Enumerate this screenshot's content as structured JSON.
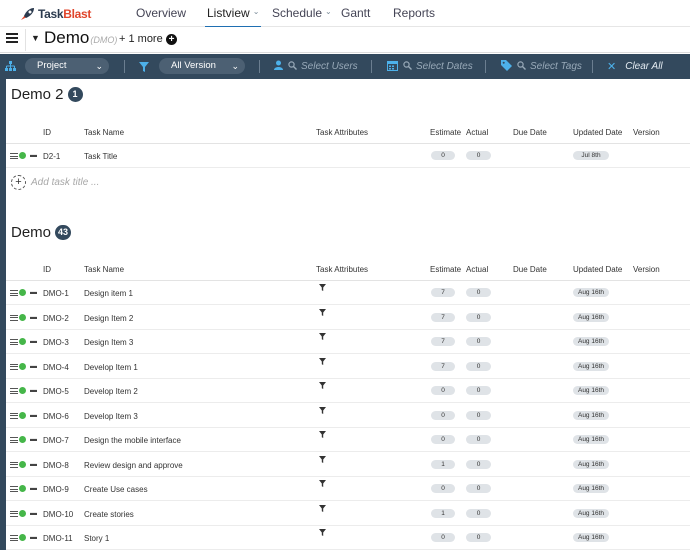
{
  "app": {
    "name_main": "Task",
    "name_accent": "Blast",
    "accent_color": "#e0452b",
    "brand_color": "#2b3a4e",
    "toolbar_color": "#33495d"
  },
  "nav": [
    {
      "label": "Overview",
      "has_caret": false,
      "active": false
    },
    {
      "label": "Listview",
      "has_caret": true,
      "active": true
    },
    {
      "label": "Schedule",
      "has_caret": true,
      "active": false
    },
    {
      "label": "Gantt",
      "has_caret": false,
      "active": false
    },
    {
      "label": "Reports",
      "has_caret": false,
      "active": false
    }
  ],
  "project": {
    "name": "Demo",
    "code": "(DMO)",
    "more": "+ 1 more",
    "menu_icon": "hamburger-icon",
    "add_icon": "plus-circle-icon"
  },
  "toolbar": {
    "group_by": "Project",
    "version": "All Version",
    "users_placeholder": "Select Users",
    "dates_placeholder": "Select Dates",
    "tags_placeholder": "Select Tags",
    "clear_all": "Clear All"
  },
  "columns": {
    "id": "ID",
    "task_name": "Task Name",
    "attributes": "Task Attributes",
    "estimate": "Estimate",
    "actual": "Actual",
    "due_date": "Due Date",
    "updated": "Updated Date",
    "version": "Version"
  },
  "sections": [
    {
      "title": "Demo 2",
      "count": "1",
      "add_placeholder": "Add task title ...",
      "tasks": [
        {
          "id": "D2-1",
          "name": "Task Title",
          "estimate": "0",
          "actual": "0",
          "updated": "Jul 8th",
          "has_attr": false
        }
      ]
    },
    {
      "title": "Demo",
      "count": "43",
      "tasks": [
        {
          "id": "DMO-1",
          "name": "Design item 1",
          "estimate": "7",
          "actual": "0",
          "updated": "Aug 16th",
          "has_attr": true
        },
        {
          "id": "DMO-2",
          "name": "Design Item 2",
          "estimate": "7",
          "actual": "0",
          "updated": "Aug 16th",
          "has_attr": true
        },
        {
          "id": "DMO-3",
          "name": "Design Item 3",
          "estimate": "7",
          "actual": "0",
          "updated": "Aug 16th",
          "has_attr": true
        },
        {
          "id": "DMO-4",
          "name": "Develop Item 1",
          "estimate": "7",
          "actual": "0",
          "updated": "Aug 16th",
          "has_attr": true
        },
        {
          "id": "DMO-5",
          "name": "Develop Item 2",
          "estimate": "0",
          "actual": "0",
          "updated": "Aug 16th",
          "has_attr": true
        },
        {
          "id": "DMO-6",
          "name": "Develop Item 3",
          "estimate": "0",
          "actual": "0",
          "updated": "Aug 16th",
          "has_attr": true
        },
        {
          "id": "DMO-7",
          "name": "Design the mobile interface",
          "estimate": "0",
          "actual": "0",
          "updated": "Aug 16th",
          "has_attr": true
        },
        {
          "id": "DMO-8",
          "name": "Review design and approve",
          "estimate": "1",
          "actual": "0",
          "updated": "Aug 16th",
          "has_attr": true
        },
        {
          "id": "DMO-9",
          "name": "Create Use cases",
          "estimate": "0",
          "actual": "0",
          "updated": "Aug 16th",
          "has_attr": true
        },
        {
          "id": "DMO-10",
          "name": "Create stories",
          "estimate": "1",
          "actual": "0",
          "updated": "Aug 16th",
          "has_attr": true
        },
        {
          "id": "DMO-11",
          "name": "Story 1",
          "estimate": "0",
          "actual": "0",
          "updated": "Aug 16th",
          "has_attr": true
        }
      ]
    }
  ],
  "status_color": "#45b649",
  "attr_icon": "filter-icon"
}
